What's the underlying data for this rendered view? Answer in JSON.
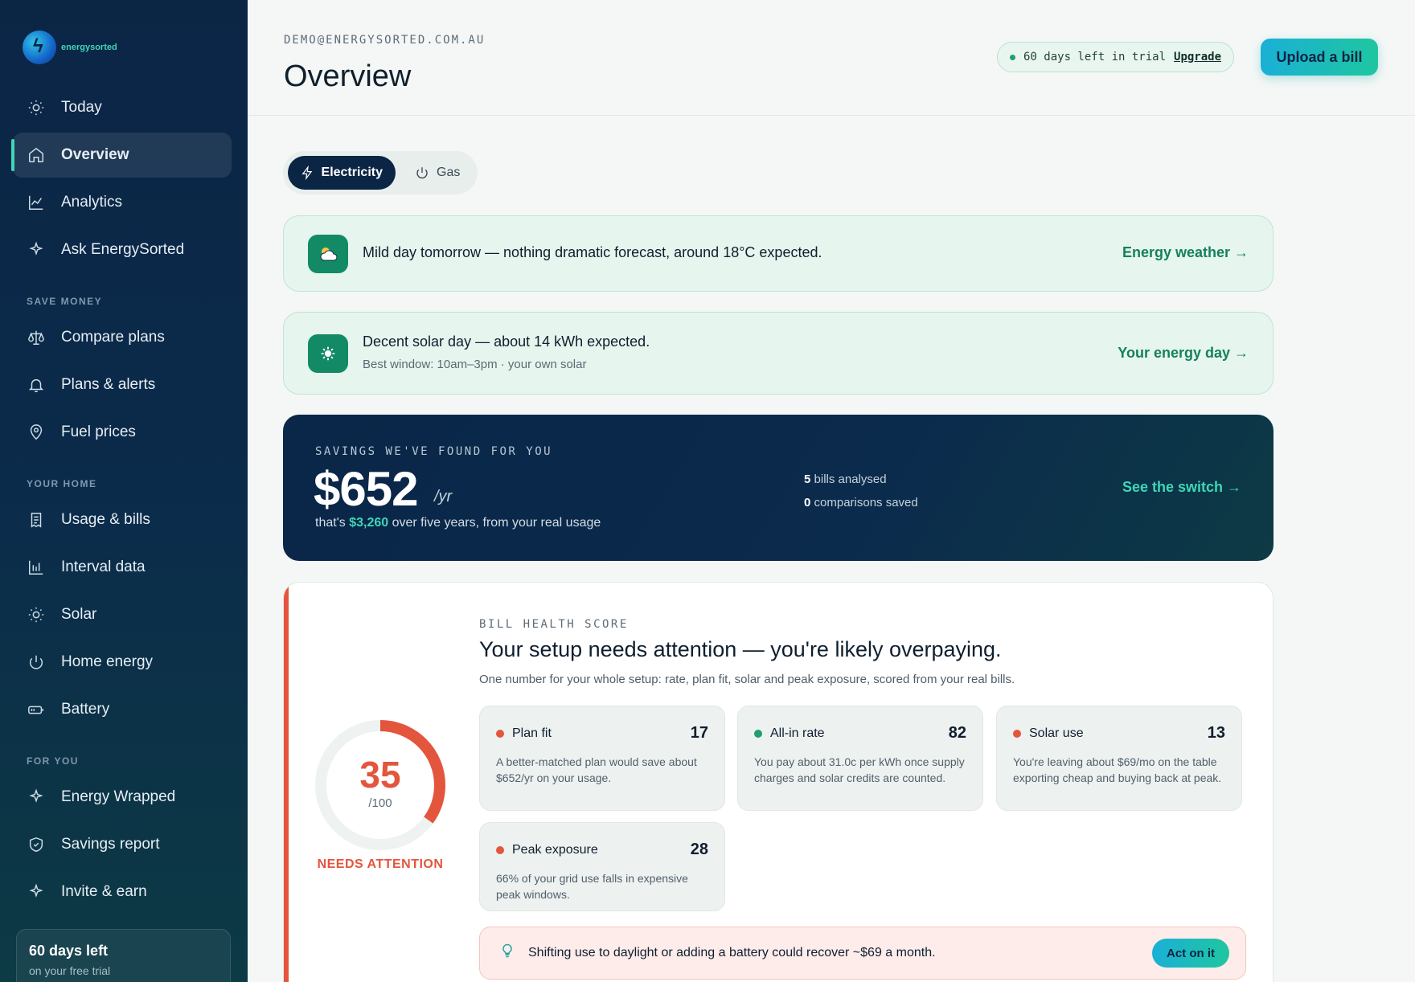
{
  "brand": {
    "name": "energysorted"
  },
  "sidebar": {
    "items": [
      {
        "label": "Today",
        "icon": "sun-icon"
      },
      {
        "label": "Overview",
        "icon": "home-icon",
        "active": true
      },
      {
        "label": "Analytics",
        "icon": "line-chart-icon"
      },
      {
        "label": "Ask EnergySorted",
        "icon": "sparkle-icon"
      }
    ],
    "sections": [
      {
        "title": "SAVE MONEY",
        "items": [
          {
            "label": "Compare plans",
            "icon": "scales-icon"
          },
          {
            "label": "Plans & alerts",
            "icon": "bell-icon"
          },
          {
            "label": "Fuel prices",
            "icon": "map-pin-icon"
          }
        ]
      },
      {
        "title": "YOUR HOME",
        "items": [
          {
            "label": "Usage & bills",
            "icon": "receipt-icon"
          },
          {
            "label": "Interval data",
            "icon": "bar-chart-icon"
          },
          {
            "label": "Solar",
            "icon": "sun-icon"
          },
          {
            "label": "Home energy",
            "icon": "power-icon"
          },
          {
            "label": "Battery",
            "icon": "battery-icon"
          }
        ]
      },
      {
        "title": "FOR YOU",
        "items": [
          {
            "label": "Energy Wrapped",
            "icon": "sparkle-icon"
          },
          {
            "label": "Savings report",
            "icon": "shield-icon"
          },
          {
            "label": "Invite & earn",
            "icon": "sparkle-icon"
          }
        ]
      }
    ],
    "trial": {
      "title": "60 days left",
      "subtitle": "on your free trial"
    }
  },
  "header": {
    "email": "DEMO@ENERGYSORTED.COM.AU",
    "title": "Overview",
    "trial_text": "60 days left in trial",
    "upgrade_label": "Upgrade",
    "upload_label": "Upload a bill"
  },
  "fuel_toggle": {
    "electricity": "Electricity",
    "gas": "Gas",
    "selected": "Electricity"
  },
  "weather_card": {
    "icon": "cloud-sun-icon",
    "text": "Mild day tomorrow — nothing dramatic forecast, around 18°C expected.",
    "link": "Energy weather →"
  },
  "solar_card": {
    "icon": "sun-icon",
    "text": "Decent solar day — about 14 kWh expected.",
    "subtext": "Best window: 10am–3pm · your own solar",
    "link": "Your energy day →"
  },
  "savings": {
    "label": "SAVINGS WE'VE FOUND FOR YOU",
    "amount": "$652",
    "unit": "/yr",
    "sub_prefix": "that's",
    "sub_amount": "$3,260",
    "sub_suffix": "over five years, from your real usage",
    "bills_count": "5",
    "bills_label": "bills analysed",
    "comparisons_count": "0",
    "comparisons_label": "comparisons saved",
    "link": "See the switch →"
  },
  "health": {
    "label": "BILL HEALTH SCORE",
    "title": "Your setup needs attention — you're likely overpaying.",
    "description": "One number for your whole setup: rate, plan fit, solar and peak exposure, scored from your real bills.",
    "score": 35,
    "score_max": "/100",
    "status": "NEEDS ATTENTION",
    "colors": {
      "bad": "#e4553d",
      "good": "#1f9e6e",
      "track": "#eef2f1"
    },
    "metrics": [
      {
        "name": "Plan fit",
        "value": "17",
        "status": "bad",
        "description": "A better-matched plan would save about $652/yr on your usage."
      },
      {
        "name": "All-in rate",
        "value": "82",
        "status": "good",
        "description": "You pay about 31.0c per kWh once supply charges and solar credits are counted."
      },
      {
        "name": "Solar use",
        "value": "13",
        "status": "bad",
        "description": "You're leaving about $69/mo on the table exporting cheap and buying back at peak."
      },
      {
        "name": "Peak exposure",
        "value": "28",
        "status": "bad",
        "description": "66% of your grid use falls in expensive peak windows."
      }
    ],
    "tip": {
      "icon": "lightbulb-icon",
      "text": "Shifting use to daylight or adding a battery could recover ~$69 a month.",
      "action": "Act on it"
    }
  }
}
